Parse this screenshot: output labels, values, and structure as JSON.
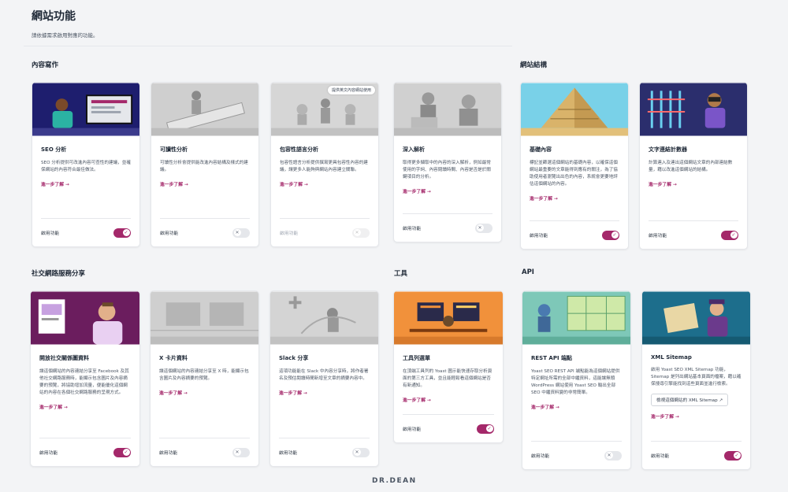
{
  "header": {
    "title": "網站功能",
    "subtitle": "請依據需求啟用對應的功能。"
  },
  "sections": {
    "content": "內容寫作",
    "structure": "網站結構",
    "social": "社交網路服務分享",
    "tools": "工具",
    "api": "API"
  },
  "cards": [
    {
      "title": "SEO 分析",
      "desc": "SEO 分析提供可改進內容可查性的建議，並確保網站的內容符合最佳做法。",
      "learn": "進一步了解 →",
      "toggle_label": "啟用功能",
      "state": "on"
    },
    {
      "title": "可讀性分析",
      "desc": "可讀性分析會提供能改進內容結構及樣式的建議。",
      "learn": "進一步了解 →",
      "toggle_label": "啟用功能",
      "state": "off"
    },
    {
      "title": "包容性語言分析",
      "desc": "包容性語言分析提供撰寫更具包容性內容的建議，讓更多人能夠與網站內容建立關聯。",
      "learn": "進一步了解 →",
      "toggle_label": "啟用功能",
      "state": "disabled",
      "badge": "提供英文內容網站使用"
    },
    {
      "title": "深入解析",
      "desc": "取得更多擷取中的內容的深入解析，例如最常使用的字詞、內容閱讀時間、內容是否是於關鍵項目的分析。",
      "learn": "進一步了解 →",
      "toggle_label": "啟用功能",
      "state": "off"
    },
    {
      "title": "基礎內容",
      "desc": "標記並篩選這個網站的基礎內容，以確保這個網站最重要的文章能得到應有的關注，為了協助使用者瀏覽出出色的內容，系統會更要地評估這個網站的內容。",
      "learn": "進一步了解 →",
      "toggle_label": "啟用功能",
      "state": "on"
    },
    {
      "title": "文字連結計數器",
      "desc": "計算連入及連出這個網站文章的內部連結數量，藉以改進這個網站的結構。",
      "learn": "進一步了解 →",
      "toggle_label": "啟用功能",
      "state": "on"
    },
    {
      "title": "開放社交關係圖資料",
      "desc": "讓這個網站的內容連結分享至 Facebook 及其他社交網路服務時，能顯示包含圖片及內容摘要的預覽，將協助增加流量，便能優化這個網站的內容在各個社交網路服務的呈現方式。",
      "learn": "進一步了解 →",
      "toggle_label": "啟用功能",
      "state": "on"
    },
    {
      "title": "X 卡片資料",
      "desc": "讓這個網站的內容連結分享至 X 時，能顯示包含圖片及內容摘要的預覽。",
      "learn": "進一步了解 →",
      "toggle_label": "啟用功能",
      "state": "off"
    },
    {
      "title": "Slack 分享",
      "desc": "這項功能能在 Slack 中內容分享時，將作者署名及預估閱讀時間新增至文章的摘要內容中。",
      "learn": "進一步了解 →",
      "toggle_label": "啟用功能",
      "state": "off"
    },
    {
      "title": "工具列選單",
      "desc": "在頂端工具列的 Yoast 圖示能快速存取分析頁面的第三方工具，並且能輕鬆看這個網站是否有新通知。",
      "learn": "進一步了解 →",
      "toggle_label": "啟用功能",
      "state": "on"
    },
    {
      "title": "REST API 端點",
      "desc": "Yoast SEO REST API 端點能為這個網站提供特定網址所需的全部中繼資料，這能讓無頭 WordPress 網站使用 Yoast SEO 輸出全部 SEO 中繼資料變的非常簡單。",
      "learn": "進一步了解 →",
      "toggle_label": "啟用功能",
      "state": "off"
    },
    {
      "title": "XML Sitemap",
      "desc": "啟用 Yoast SEO XML Sitemap 功能，Sitemap 是列出網站基本頁面的檔案，藉以確保搜尋引擎能找到這些頁面並進行檢索。",
      "ext_label": "檢視這個網站的 XML Sitemap",
      "learn": "進一步了解 →",
      "toggle_label": "啟用功能",
      "state": "on"
    }
  ],
  "footer": {
    "logo": "DR.DEAN"
  }
}
